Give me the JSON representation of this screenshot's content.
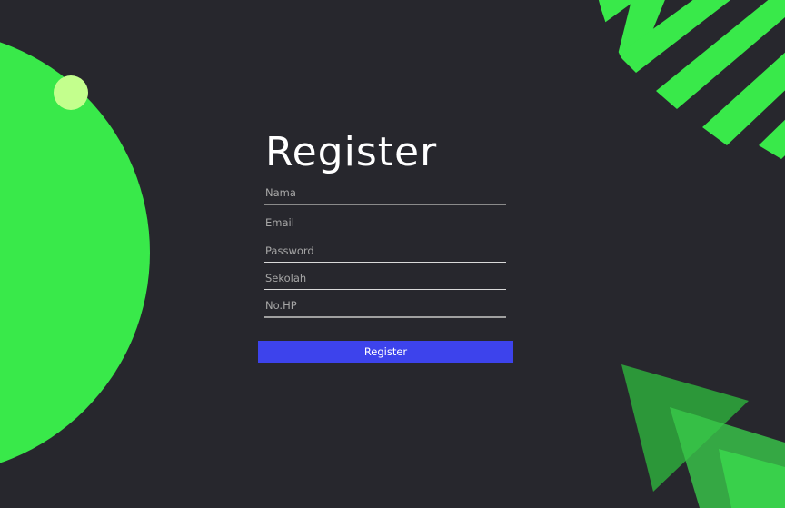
{
  "title": "Register",
  "fields": [
    {
      "placeholder": "Nama"
    },
    {
      "placeholder": "Email"
    },
    {
      "placeholder": "Password"
    },
    {
      "placeholder": "Sekolah"
    },
    {
      "placeholder": "No.HP"
    }
  ],
  "button": {
    "label": "Register"
  },
  "colors": {
    "background": "#27272d",
    "accent_green": "#39e94a",
    "light_green": "#c3ff8d",
    "button_blue": "#3d43ec"
  }
}
